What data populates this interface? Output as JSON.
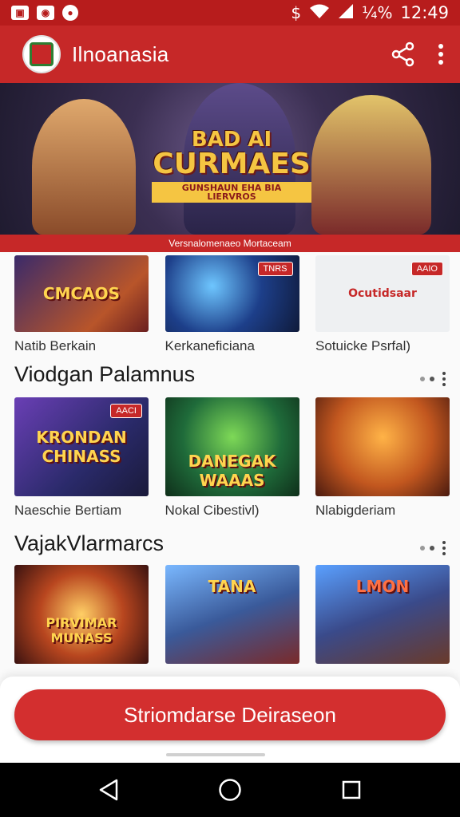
{
  "status_bar": {
    "battery": "¼%",
    "time": "12:49"
  },
  "app_bar": {
    "title": "Ilnoanasia"
  },
  "banner": {
    "title_line1": "BAD AI",
    "title_line2": "CURMAES",
    "tagline": "GUNSHAUN EHA BIA LIERVROS",
    "caption": "Versnalomenaeo Mortaceam"
  },
  "row1": {
    "cards": [
      {
        "art_text": "CMCAOS",
        "badge": "",
        "label": "Natib Berkain"
      },
      {
        "art_text": "",
        "badge": "TNRS",
        "label": "Kerkaneficiana"
      },
      {
        "art_text": "Ocutidsaar",
        "badge": "AAIO",
        "label": "Sotuicke Psrfal)"
      }
    ]
  },
  "section1": {
    "title": "Viodgan Palamnus"
  },
  "row2": {
    "cards": [
      {
        "art_text": "KRONDAN CHINASS",
        "badge": "AACI",
        "label": "Naeschie Bertiam"
      },
      {
        "art_text": "DANEGAK WAAAS",
        "badge": "",
        "label": "Nokal Cibestivl)"
      }
    ]
  },
  "row2_card3": {
    "art_text": "",
    "badge": "",
    "label": "Nlabigderiam"
  },
  "section2": {
    "title": "VajakVlarmarcs"
  },
  "row3": {
    "cards": [
      {
        "art_text": "PIRVIMAR MUNASS",
        "badge": ""
      },
      {
        "art_text": "TANA",
        "badge": ""
      },
      {
        "art_text": "LMON",
        "badge": ""
      }
    ]
  },
  "cta": {
    "label": "Striomdarse Deiraseon"
  },
  "colors": {
    "primary": "#c62828",
    "status_bar": "#b71c1c",
    "cta": "#d32f2f"
  },
  "icons": [
    "app-logo-icon",
    "share-icon",
    "more-vert-icon",
    "back-icon",
    "home-icon",
    "recents-icon",
    "wifi-icon",
    "signal-icon",
    "dollar-icon"
  ]
}
